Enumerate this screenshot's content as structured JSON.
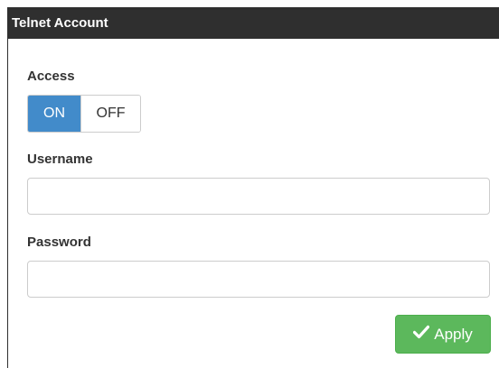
{
  "panel": {
    "title": "Telnet Account"
  },
  "access": {
    "label": "Access",
    "on_label": "ON",
    "off_label": "OFF",
    "selected": "ON"
  },
  "username": {
    "label": "Username",
    "value": "",
    "placeholder": ""
  },
  "password": {
    "label": "Password",
    "value": "",
    "placeholder": ""
  },
  "apply_button": {
    "label": "Apply",
    "icon": "check-icon"
  },
  "colors": {
    "header_bg": "#2f2f2f",
    "toggle_active": "#428bca",
    "apply_bg": "#5cb85c"
  }
}
